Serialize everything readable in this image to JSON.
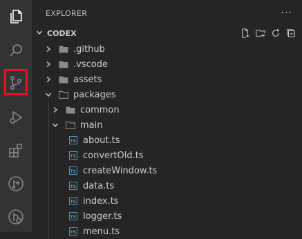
{
  "explorer": {
    "title": "EXPLORER",
    "more": "···",
    "section": "CODEX",
    "items": [
      {
        "label": ".github",
        "kind": "folder",
        "expanded": false
      },
      {
        "label": ".vscode",
        "kind": "folder",
        "expanded": false
      },
      {
        "label": "assets",
        "kind": "folder",
        "expanded": false
      },
      {
        "label": "packages",
        "kind": "folder",
        "expanded": true
      },
      {
        "label": "common",
        "kind": "folder",
        "expanded": false
      },
      {
        "label": "main",
        "kind": "folder",
        "expanded": true
      },
      {
        "label": "about.ts",
        "kind": "ts"
      },
      {
        "label": "convertOld.ts",
        "kind": "ts"
      },
      {
        "label": "createWindow.ts",
        "kind": "ts"
      },
      {
        "label": "data.ts",
        "kind": "ts"
      },
      {
        "label": "index.ts",
        "kind": "ts"
      },
      {
        "label": "logger.ts",
        "kind": "ts"
      },
      {
        "label": "menu.ts",
        "kind": "ts"
      }
    ],
    "ts_badge": "TS"
  },
  "activity_bar": {
    "icons": [
      "explorer-icon",
      "search-icon",
      "source-control-icon",
      "run-debug-icon",
      "extensions-icon",
      "git-graph-icon",
      "git-lens-icon"
    ],
    "highlighted": "source-control-icon",
    "highlight_color": "#e81123"
  }
}
